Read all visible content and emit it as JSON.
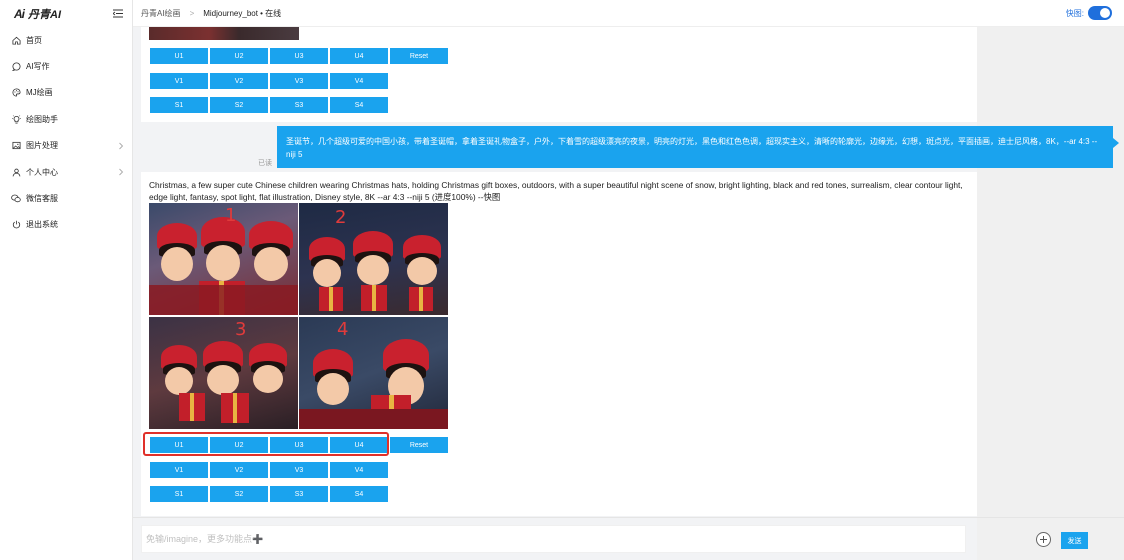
{
  "app": {
    "logo_text": "丹青AI",
    "logo_mark": "Ai"
  },
  "sidebar": {
    "items": [
      {
        "label": "首页",
        "icon": "home-icon"
      },
      {
        "label": "AI写作",
        "icon": "chat-icon"
      },
      {
        "label": "MJ绘画",
        "icon": "palette-icon"
      },
      {
        "label": "绘图助手",
        "icon": "bulb-icon"
      },
      {
        "label": "图片处理",
        "icon": "image-icon"
      },
      {
        "label": "个人中心",
        "icon": "user-icon"
      },
      {
        "label": "微信客服",
        "icon": "wechat-icon"
      },
      {
        "label": "退出系统",
        "icon": "power-icon"
      }
    ]
  },
  "header": {
    "breadcrumb_root": "丹青AI绘画",
    "breadcrumb_current": "Midjourney_bot • 在线",
    "quick_label": "快图:",
    "quick_enabled": true
  },
  "messages": {
    "first_card": {
      "rows": [
        [
          "U1",
          "U2",
          "U3",
          "U4",
          "Reset"
        ],
        [
          "V1",
          "V2",
          "V3",
          "V4"
        ],
        [
          "S1",
          "S2",
          "S3",
          "S4"
        ]
      ]
    },
    "user_prompt": "圣诞节，几个超级可爱的中国小孩，带着圣诞帽，拿着圣诞礼物盒子，户外，下着雪的超级漂亮的夜景，明亮的灯光，黑色和红色色调，超现实主义，清晰的轮廓光，边缘光，幻想，斑点光，平面插画，迪士尼风格，8K，--ar 4:3 --niji 5",
    "read_status": "已读",
    "bot_prompt": "Christmas, a few super cute Chinese children wearing Christmas hats, holding Christmas gift boxes, outdoors, with a super beautiful night scene of snow, bright lighting, black and red tones, surrealism, clear contour light, edge light, fantasy, spot light, flat illustration, Disney style, 8K --ar 4:3 --niji 5 (进度100%) --快图",
    "tile_numbers": [
      "1",
      "2",
      "3",
      "4"
    ],
    "second_card": {
      "rows": [
        [
          "U1",
          "U2",
          "U3",
          "U4",
          "Reset"
        ],
        [
          "V1",
          "V2",
          "V3",
          "V4"
        ],
        [
          "S1",
          "S2",
          "S3",
          "S4"
        ]
      ]
    }
  },
  "composer": {
    "placeholder": "免输/imagine，更多功能点➕",
    "send_label": "发送"
  },
  "colors": {
    "accent": "#1aa3ee",
    "toggle": "#1f6fdc",
    "highlight": "#e0302a"
  }
}
